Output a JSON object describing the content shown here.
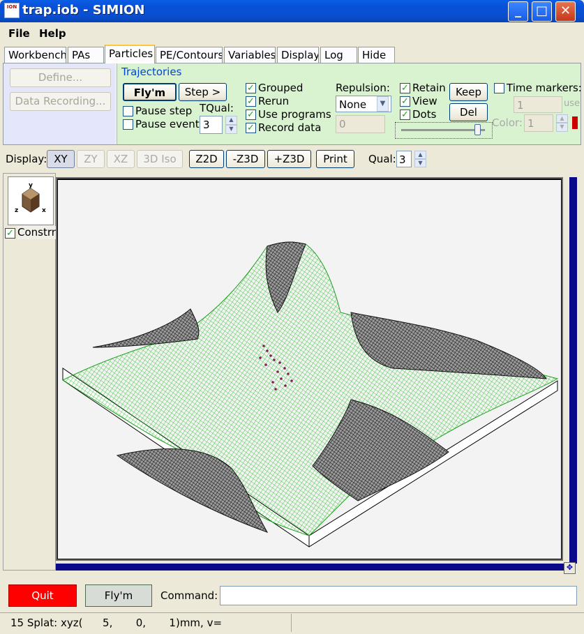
{
  "window": {
    "title": "trap.iob - SIMION",
    "icon_text": "ION",
    "minimize": "_",
    "maximize": "□",
    "close": "✕"
  },
  "menu": {
    "file": "File",
    "help": "Help"
  },
  "tabs": [
    {
      "label": "Workbench",
      "active": false
    },
    {
      "label": "PAs",
      "active": false
    },
    {
      "label": "Particles",
      "active": true
    },
    {
      "label": "PE/Contours",
      "active": false
    },
    {
      "label": "Variables",
      "active": false
    },
    {
      "label": "Display",
      "active": false
    },
    {
      "label": "Log",
      "active": false
    },
    {
      "label": "Hide",
      "active": false
    }
  ],
  "particles": {
    "define": "Define...",
    "data_recording": "Data Recording...",
    "group_title": "Trajectories",
    "flym": "Fly'm",
    "step": "Step >",
    "pause_step": "Pause step",
    "pause_event": "Pause event",
    "tqual_label": "TQual:",
    "tqual_value": "3",
    "grouped": "Grouped",
    "rerun": "Rerun",
    "use_programs": "Use programs",
    "record_data": "Record data",
    "repulsion_label": "Repulsion:",
    "repulsion_value": "None",
    "repulsion_amount": "0",
    "retain": "Retain",
    "view": "View",
    "dots": "Dots",
    "keep": "Keep",
    "del": "Del",
    "time_markers": "Time markers:",
    "time_value": "1",
    "time_unit": "use",
    "color_label": "Color:",
    "color_value": "1",
    "color_swatch": "#cc0000",
    "checks": {
      "pause_step": false,
      "pause_event": false,
      "grouped": true,
      "rerun": true,
      "use_programs": true,
      "record_data": true,
      "retain": true,
      "view": true,
      "dots": true,
      "time_markers": false
    }
  },
  "display_toolbar": {
    "label": "Display:",
    "xy": "XY",
    "zy": "ZY",
    "xz": "XZ",
    "iso": "3D Iso",
    "z2d": "Z2D",
    "mz3d": "-Z3D",
    "pz3d": "+Z3D",
    "print": "Print",
    "qual_label": "Qual:",
    "qual_value": "3"
  },
  "view": {
    "thumb_axes": {
      "y": "y",
      "z": "z",
      "x": "x"
    },
    "constrain_label": "Constrn",
    "constrain_checked": true,
    "mesh_color": "#1fbf1f",
    "electrode_color": "#111111",
    "trajectory_color": "#8b1a5a"
  },
  "bottom": {
    "quit": "Quit",
    "flym": "Fly'm",
    "command_label": "Command:",
    "command_value": ""
  },
  "status": {
    "text": "15 Splat: xyz(      5,       0,       1)mm, v="
  }
}
